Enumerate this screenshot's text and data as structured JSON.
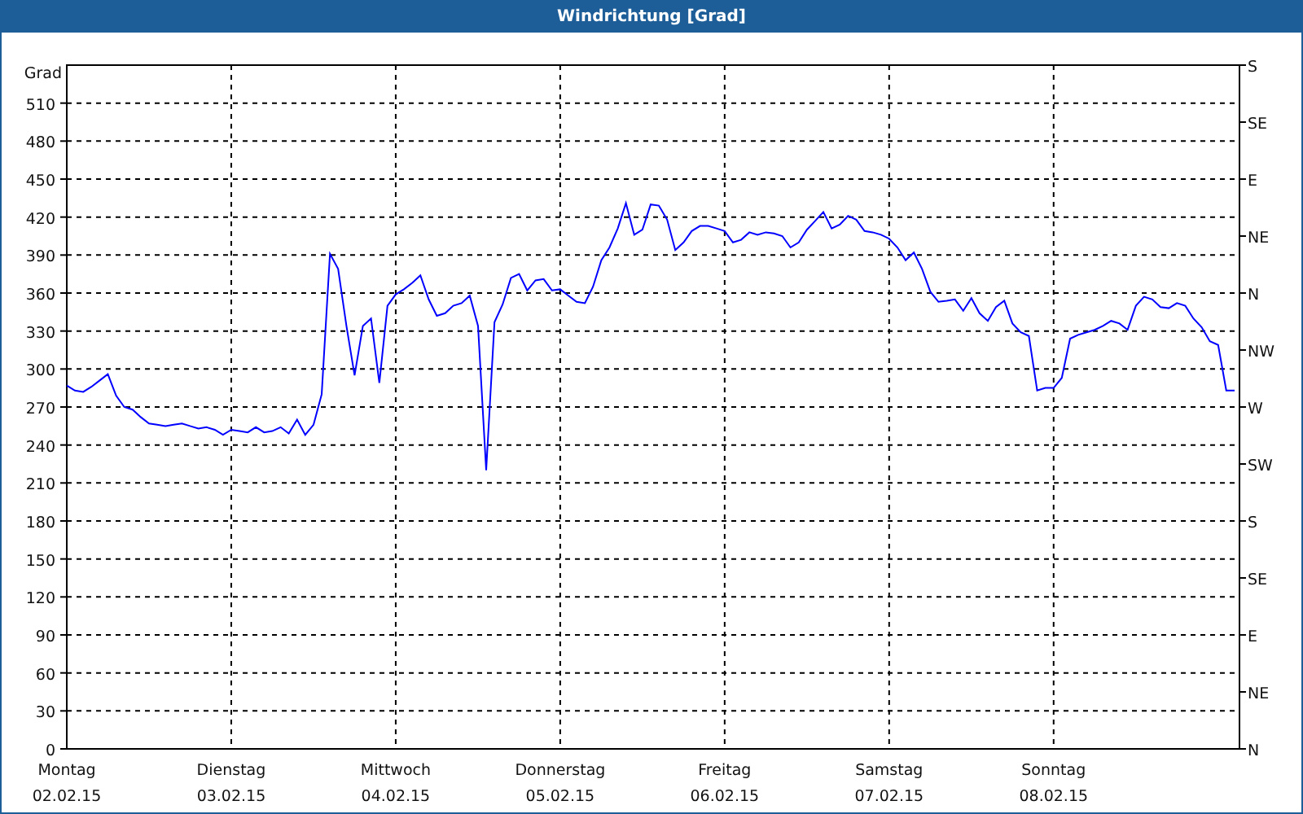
{
  "window": {
    "title": "Windrichtung [Grad]"
  },
  "chart": {
    "right_axis_labels": [
      "S",
      "SE",
      "E",
      "NE",
      "N",
      "NW",
      "W",
      "SW",
      "S",
      "SE",
      "E",
      "NE",
      "N"
    ],
    "chart_data": {
      "type": "line",
      "ylabel": "Grad",
      "grid": true,
      "ylim": [
        0,
        540
      ],
      "yticks": [
        0,
        30,
        60,
        90,
        120,
        150,
        180,
        210,
        240,
        270,
        300,
        330,
        360,
        390,
        420,
        450,
        480,
        510
      ],
      "categories": [
        "Montag 02.02.15",
        null,
        null,
        null,
        null,
        null,
        null,
        null,
        null,
        null,
        null,
        null,
        null,
        null,
        null,
        null,
        null,
        null,
        null,
        null,
        "Dienstag 03.02.15",
        null,
        null,
        null,
        null,
        null,
        null,
        null,
        null,
        null,
        null,
        null,
        null,
        null,
        null,
        null,
        null,
        null,
        null,
        null,
        "Mittwoch 04.02.15",
        null,
        null,
        null,
        null,
        null,
        null,
        null,
        null,
        null,
        null,
        null,
        null,
        null,
        null,
        null,
        null,
        null,
        null,
        null,
        "Donnerstag 05.02.15",
        null,
        null,
        null,
        null,
        null,
        null,
        null,
        null,
        null,
        null,
        null,
        null,
        null,
        null,
        null,
        null,
        null,
        null,
        null,
        "Freitag 06.02.15",
        null,
        null,
        null,
        null,
        null,
        null,
        null,
        null,
        null,
        null,
        null,
        null,
        null,
        null,
        null,
        null,
        null,
        null,
        null,
        "Samstag 07.02.15",
        null,
        null,
        null,
        null,
        null,
        null,
        null,
        null,
        null,
        null,
        null,
        null,
        null,
        null,
        null,
        null,
        null,
        null,
        null,
        "Sonntag 08.02.15",
        null,
        null,
        null,
        null,
        null,
        null,
        null,
        null,
        null,
        null,
        null,
        null,
        null,
        null,
        null,
        null,
        null,
        null,
        null,
        null,
        null,
        null
      ],
      "series": [
        {
          "color": "#0000ff",
          "values": [
            287,
            283,
            282,
            286,
            291,
            296,
            279,
            270,
            268,
            262,
            257,
            256,
            255,
            256,
            257,
            255,
            253,
            254,
            252,
            248,
            252,
            251,
            250,
            254,
            250,
            251,
            254,
            249,
            260,
            248,
            256,
            280,
            391,
            379,
            334,
            295,
            334,
            340,
            289,
            350,
            359,
            363,
            368,
            374,
            355,
            342,
            344,
            350,
            352,
            358,
            334,
            220,
            337,
            351,
            372,
            375,
            362,
            370,
            371,
            362,
            363,
            358,
            353,
            352,
            365,
            386,
            396,
            411,
            431,
            406,
            410,
            430,
            429,
            418,
            394,
            400,
            409,
            413,
            413,
            411,
            409,
            400,
            402,
            408,
            406,
            408,
            407,
            405,
            396,
            400,
            410,
            417,
            424,
            411,
            414,
            421,
            418,
            409,
            408,
            406,
            403,
            396,
            386,
            392,
            379,
            361,
            353,
            354,
            355,
            346,
            356,
            344,
            338,
            349,
            354,
            336,
            329,
            326,
            283,
            285,
            285,
            293,
            324,
            327,
            329,
            331,
            334,
            338,
            336,
            331,
            350,
            357,
            355,
            349,
            348,
            352,
            350,
            340,
            333,
            322,
            319,
            283,
            283
          ]
        }
      ]
    }
  }
}
